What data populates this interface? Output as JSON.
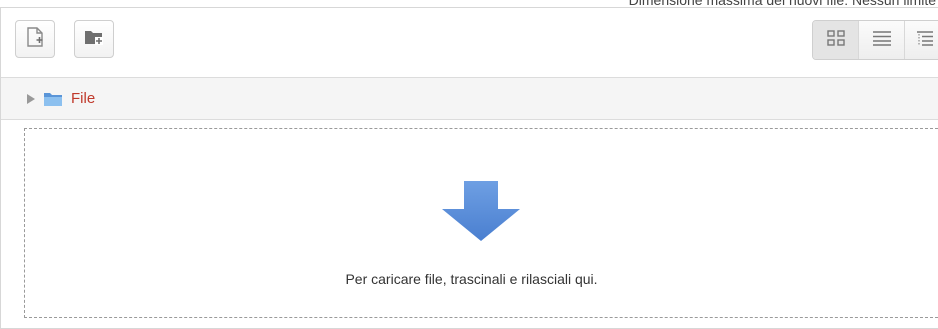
{
  "header_note": "Dimensione massima dei nuovi file: Nessun limite",
  "toolbar": {
    "add_icon": "add-file-icon",
    "folder_icon": "create-folder-icon",
    "view_icons": [
      "grid-view-icon",
      "list-view-icon",
      "tree-view-icon"
    ]
  },
  "path": {
    "folder_icon": "folder-icon",
    "label": "File"
  },
  "dropzone": {
    "icon": "download-arrow-icon",
    "text": "Per caricare file, trascinali e rilasciali qui."
  },
  "colors": {
    "link": "#c0392b",
    "arrow": "#5b8fd8",
    "folder": "#6aa3e0"
  }
}
